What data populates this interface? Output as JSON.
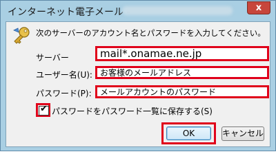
{
  "window": {
    "title": "インターネット電子メール - ",
    "close_glyph": "x"
  },
  "prompt": "次のサーバーのアカウント名とパスワードを入力してください。",
  "fields": {
    "server_label": "サーバー",
    "server_value": "mail*.onamae.ne.jp",
    "username_label": "ユーザー名(U):",
    "username_value": "お客様のメールアドレス",
    "password_label": "パスワード(P):",
    "password_value": "メールアカウントのパスワード"
  },
  "save_password": {
    "label": "パスワードをパスワード一覧に保存する(S)",
    "checked": true,
    "check_glyph": "✔"
  },
  "buttons": {
    "ok": "OK",
    "cancel": "キャンセル"
  },
  "colors": {
    "highlight": "#e0001a",
    "title_bar": "#a9cfe3",
    "dialog_bg": "#f0f0f0"
  },
  "icons": {
    "dialog_icon": "key-icon"
  }
}
